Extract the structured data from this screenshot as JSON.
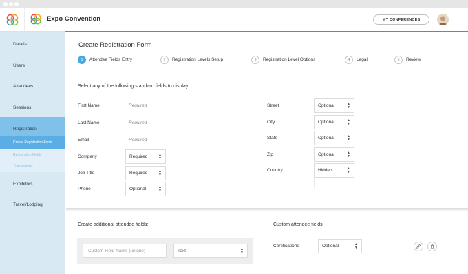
{
  "header": {
    "app_title": "Expo Convention",
    "my_conferences_label": "MY CONFERENCES",
    "accent_color": "#2ea0b8"
  },
  "sidebar": {
    "items": [
      {
        "label": "Details"
      },
      {
        "label": "Users"
      },
      {
        "label": "Attendees"
      },
      {
        "label": "Sessions"
      },
      {
        "label": "Registration"
      },
      {
        "label": "Exhibitors"
      },
      {
        "label": "Travel/Lodging"
      }
    ],
    "sub_items": [
      {
        "label": "Create Registration Form"
      },
      {
        "label": "Registration Fields"
      },
      {
        "label": "Transactions"
      }
    ]
  },
  "main": {
    "title": "Create Registration Form",
    "steps": [
      {
        "num": "1",
        "label": "Attendee Fields Entry"
      },
      {
        "num": "2",
        "label": "Registration Levels Setup"
      },
      {
        "num": "3",
        "label": "Registration Level Options"
      },
      {
        "num": "4",
        "label": "Legal"
      },
      {
        "num": "5",
        "label": "Review"
      }
    ],
    "standard_heading": "Select any of the following standard fields to display:",
    "left_fields": [
      {
        "label": "First Name",
        "value": "Required"
      },
      {
        "label": "Last Name",
        "value": "Required"
      },
      {
        "label": "Email",
        "value": "Required"
      },
      {
        "label": "Company",
        "value": "Required"
      },
      {
        "label": "Job Title",
        "value": "Required"
      },
      {
        "label": "Phone",
        "value": "Optional"
      }
    ],
    "right_fields": [
      {
        "label": "Street",
        "value": "Optional"
      },
      {
        "label": "City",
        "value": "Optional"
      },
      {
        "label": "State",
        "value": "Optional"
      },
      {
        "label": "Zip",
        "value": "Optional"
      },
      {
        "label": "Country",
        "value": "Hidden"
      }
    ],
    "additional_heading": "Create additional attendee fields:",
    "custom_field_placeholder": "Custom Field Name (unique)",
    "custom_type_value": "Text",
    "custom_heading": "Custom attendee fields:",
    "custom_fields": [
      {
        "label": "Certifications",
        "value": "Optional"
      }
    ]
  }
}
